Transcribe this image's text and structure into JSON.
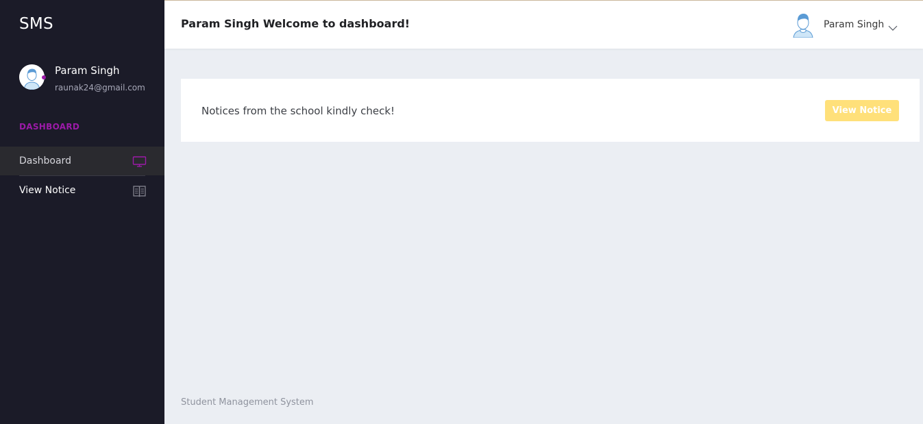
{
  "sidebar": {
    "brand": "SMS",
    "profile": {
      "name": "Param Singh",
      "email": "raunak24@gmail.com",
      "status_color": "#9c1aa8"
    },
    "section_label": "DASHBOARD",
    "items": [
      {
        "label": "Dashboard",
        "icon": "monitor-icon",
        "active": true
      },
      {
        "label": "View Notice",
        "icon": "book-icon",
        "active": false
      }
    ]
  },
  "header": {
    "title": "Param Singh Welcome to dashboard!",
    "user_name": "Param Singh",
    "user_icon": "user-avatar-icon",
    "menu_icon": "chevron-down-icon"
  },
  "main": {
    "notice_text": "Notices from the school kindly check!",
    "notice_button_label": "View Notice",
    "button_color": "#ffe07a"
  },
  "footer": {
    "text": "Student Management System"
  },
  "colors": {
    "sidebar_bg": "#1b1b28",
    "accent": "#9c1aa8",
    "page_bg": "#ebeef3"
  }
}
